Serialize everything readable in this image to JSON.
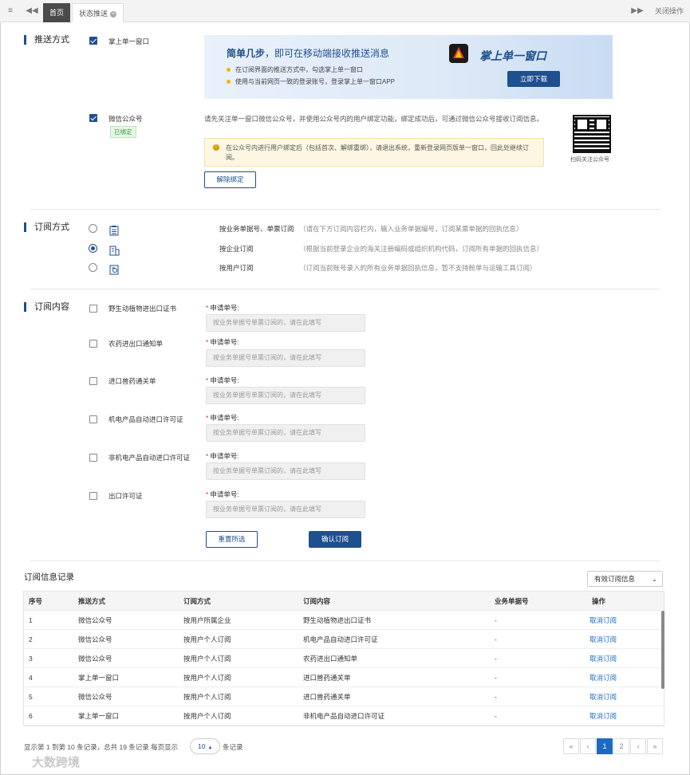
{
  "tabs": {
    "home": "首页",
    "status_push": "状态推送",
    "close_ops": "关闭操作"
  },
  "push": {
    "section_title": "推送方式",
    "option1": "掌上单一窗口",
    "banner_title_bold": "简单几步",
    "banner_title_rest": "，即可在移动端接收推送消息",
    "banner_step1": "在订阅界面的推送方式中，勾选掌上单一窗口",
    "banner_step2": "使用与当前网页一致的登录账号，登录掌上单一窗口APP",
    "app_name": "掌上单一窗口",
    "download": "立即下载",
    "option2": "微信公众号",
    "bound": "已绑定",
    "wechat_desc": "请先关注单一窗口微信公众号，并使用公众号内的用户绑定功能，绑定成功后，可通过微信公众号接收订阅信息。",
    "warn_text": "在公众号内进行用户绑定后（包括首次、解绑重绑），请退出系统，重新登录网页版单一窗口，回此处继续订阅。",
    "unbind": "解除绑定",
    "qr_label": "扫码关注公众号"
  },
  "subscribe": {
    "section_title": "订阅方式",
    "options": [
      {
        "label": "按业务单据号、单票订阅",
        "desc": "（请在下方订阅内容栏内，输入业务单据编号，订阅某票单据的回执信息）"
      },
      {
        "label": "按企业订阅",
        "desc": "（根据当前登录企业的海关注册编码或组织机构代码，订阅所有单据的回执信息）"
      },
      {
        "label": "按用户订阅",
        "desc": "（订阅当前账号录入的所有业务单据回执信息，暂不支持舱单与运输工具订阅）"
      }
    ]
  },
  "content": {
    "section_title": "订阅内容",
    "field_label": "申请单号:",
    "placeholder": "按业务单据号单票订阅的，请在此填写",
    "items": [
      "野生动植物进出口证书",
      "农药进出口通知单",
      "进口兽药通关单",
      "机电产品自动进口许可证",
      "非机电产品自动进口许可证",
      "出口许可证"
    ],
    "reset": "重置所选",
    "confirm": "确认订阅"
  },
  "records": {
    "title": "订阅信息记录",
    "filter": "有效订阅信息",
    "columns": [
      "序号",
      "推送方式",
      "订阅方式",
      "订阅内容",
      "业务单据号",
      "操作"
    ],
    "rows": [
      [
        "1",
        "微信公众号",
        "按用户所属企业",
        "野生动植物进出口证书",
        "-",
        "取消订阅"
      ],
      [
        "2",
        "微信公众号",
        "按用户个人订阅",
        "机电产品自动进口许可证",
        "-",
        "取消订阅"
      ],
      [
        "3",
        "微信公众号",
        "按用户个人订阅",
        "农药进出口通知单",
        "-",
        "取消订阅"
      ],
      [
        "4",
        "掌上单一窗口",
        "按用户个人订阅",
        "进口兽药通关单",
        "-",
        "取消订阅"
      ],
      [
        "5",
        "微信公众号",
        "按用户个人订阅",
        "进口兽药通关单",
        "-",
        "取消订阅"
      ],
      [
        "6",
        "掌上单一窗口",
        "按用户个人订阅",
        "非机电产品自动进口许可证",
        "-",
        "取消订阅"
      ]
    ],
    "footer_a": "显示第 1 到第 10 条记录，总共 19 条记录 每页显示",
    "page_size": "10",
    "footer_b": "条记录",
    "pages": [
      "«",
      "‹",
      "1",
      "2",
      "›",
      "»"
    ]
  },
  "watermark": "大数跨境"
}
